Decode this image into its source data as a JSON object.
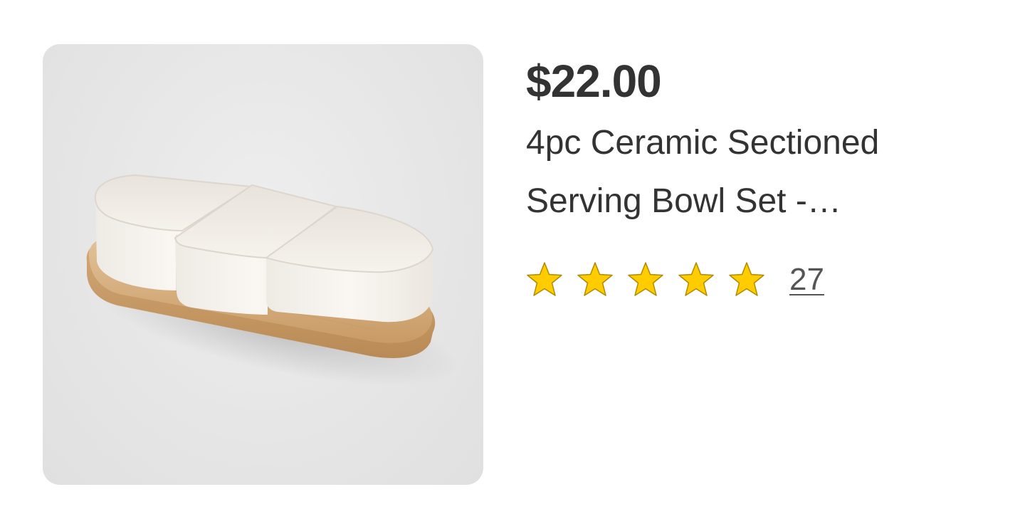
{
  "product": {
    "price": "$22.00",
    "title_line_1": "4pc Ceramic Sectioned",
    "title_line_2": "Serving Bowl Set -…",
    "image_alt": "4pc Ceramic Sectioned Serving Bowl Set",
    "rating": {
      "stars_filled": 5,
      "stars_total": 5,
      "review_count": "27"
    }
  },
  "colors": {
    "price_text": "#333333",
    "title_text": "#333333",
    "star_fill": "#FFCC00",
    "star_stroke": "#B08A00",
    "review_link": "#555555",
    "image_background": "#E6E6E6",
    "tray_wood": "#D9B489",
    "bowl_ceramic": "#F7F3EE"
  }
}
